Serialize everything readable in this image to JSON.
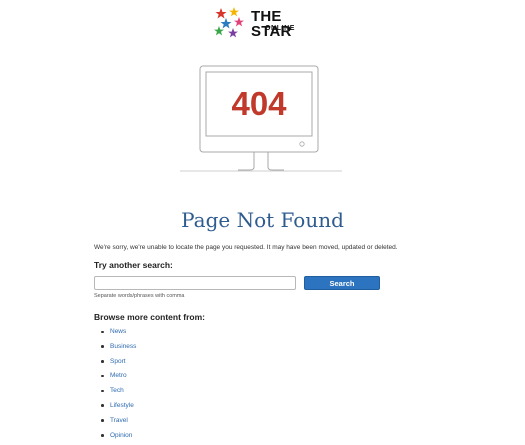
{
  "header": {
    "logo": {
      "name": "star-logo",
      "title": "THE STAR",
      "subtitle": "ONLINE"
    }
  },
  "error_graphic": {
    "code": "404",
    "code_color": "#c0392b",
    "icon": "monitor-icon"
  },
  "main": {
    "title": "Page Not Found",
    "message": "We're sorry, we're unable to locate the page you requested. It may have been moved, updated or deleted.",
    "search": {
      "heading": "Try another search:",
      "value": "",
      "placeholder": "",
      "button_label": "Search",
      "hint": "Separate words/phrases with comma"
    },
    "browse": {
      "heading": "Browse more content from:",
      "items": [
        {
          "label": "News"
        },
        {
          "label": "Business"
        },
        {
          "label": "Sport"
        },
        {
          "label": "Metro"
        },
        {
          "label": "Tech"
        },
        {
          "label": "Lifestyle"
        },
        {
          "label": "Travel"
        },
        {
          "label": "Opinion"
        }
      ]
    }
  },
  "colors": {
    "title": "#2f5c8f",
    "link": "#2e6bb0",
    "button": "#2d74c0",
    "error_code": "#c0392b"
  }
}
